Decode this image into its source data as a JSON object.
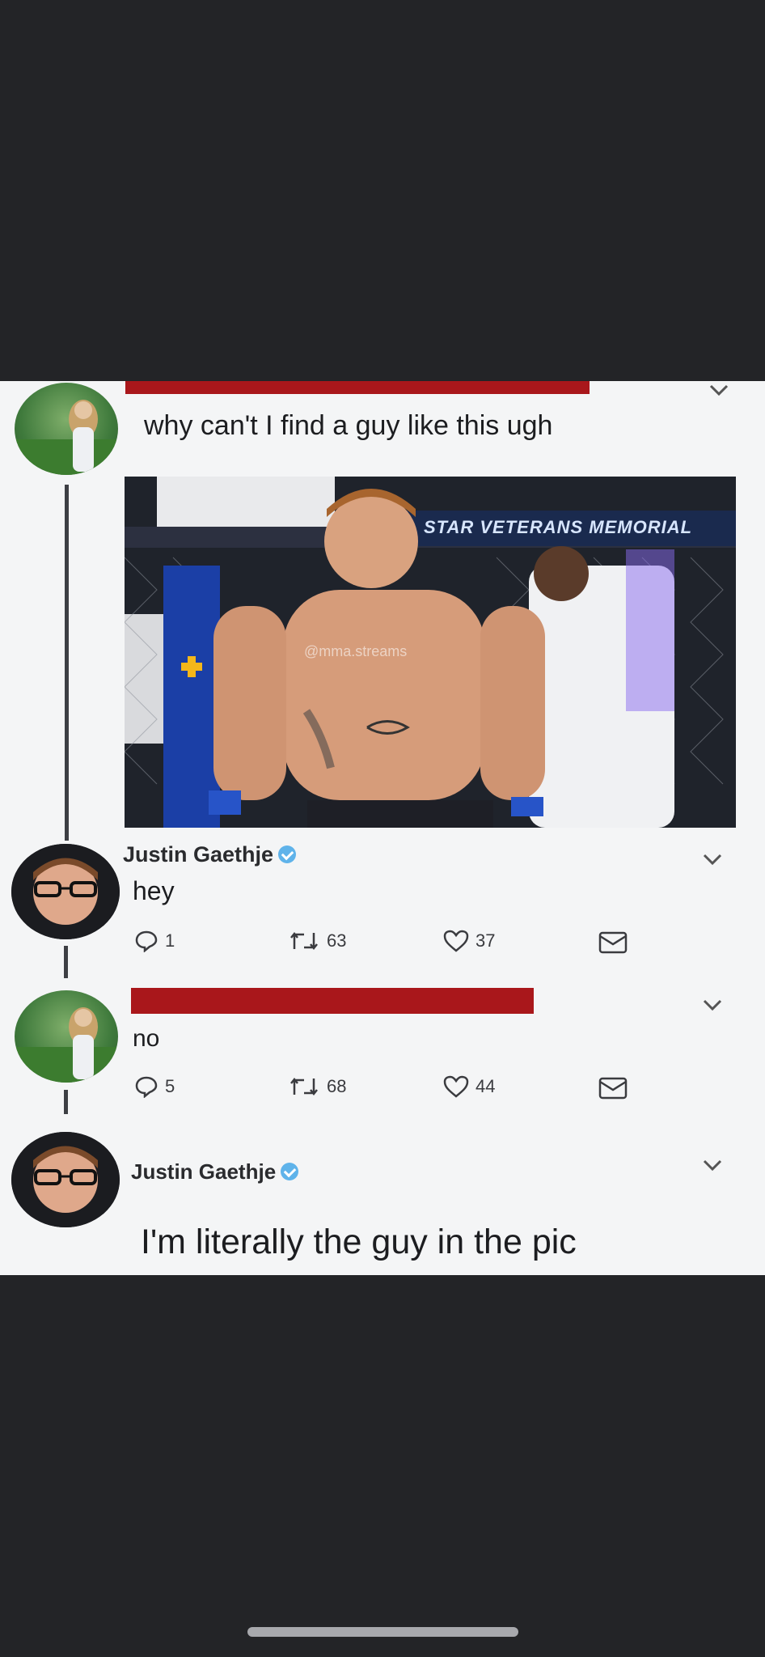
{
  "tweets": [
    {
      "text": "why can't I find a guy like this ugh",
      "photo_watermark": "@mma.streams",
      "photo_banner": "STAR VETERANS MEMORIAL"
    },
    {
      "author": "Justin Gaethje",
      "text": "hey",
      "replies": "1",
      "retweets": "63",
      "likes": "37"
    },
    {
      "text": "no",
      "replies": "5",
      "retweets": "68",
      "likes": "44"
    },
    {
      "author": "Justin Gaethje",
      "text": "I'm literally the guy in the pic"
    }
  ],
  "colors": {
    "background": "#232427",
    "card": "#f4f5f6",
    "redaction": "#a9171b",
    "verified": "#5fb3ea"
  }
}
